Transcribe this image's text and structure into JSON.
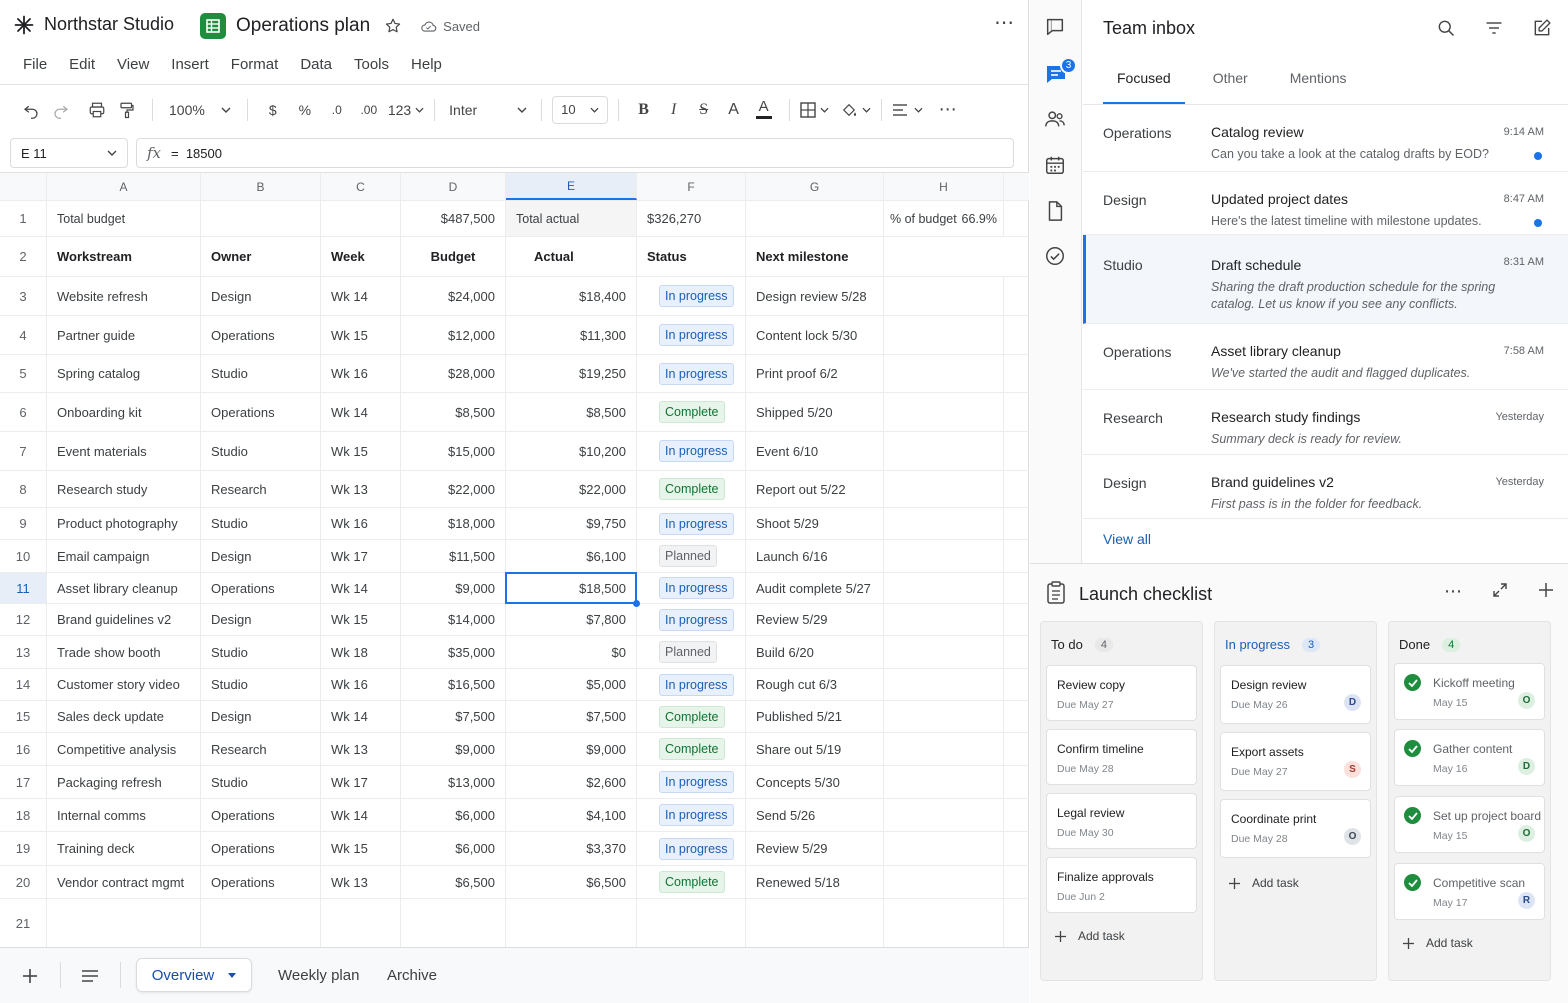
{
  "app": {
    "brand": "Northstar Studio",
    "doc_title": "Operations plan",
    "saved": "Saved"
  },
  "menu": [
    "File",
    "Edit",
    "View",
    "Insert",
    "Format",
    "Data",
    "Tools",
    "Help"
  ],
  "toolbar": {
    "zoom": "100%",
    "currency": "$",
    "percent": "%",
    "dec_less": ".0",
    "dec_more": ".00",
    "number_format": "123",
    "font": "Inter",
    "font_size": "10"
  },
  "formula_bar": {
    "cell_ref": "E 11",
    "fx": "fx",
    "formula": "=  18500"
  },
  "columns": [
    "A",
    "B",
    "C",
    "D",
    "E",
    "F",
    "G",
    "H"
  ],
  "row1": {
    "row": "1",
    "a": "Total budget",
    "d": "$487,500",
    "e": "Total actual",
    "f": "$326,270",
    "h_label": "% of budget",
    "h_value": "66.9%"
  },
  "row2": {
    "row": "2",
    "headers": [
      "Workstream",
      "Owner",
      "Week",
      "Budget",
      "Actual",
      "Status",
      "Next milestone"
    ]
  },
  "rows": [
    {
      "row": "3",
      "workstream": "Website refresh",
      "owner": "Design",
      "week": "Wk 14",
      "budget": "$24,000",
      "actual": "$18,400",
      "status": "In progress",
      "status_kind": "progress",
      "milestone": "Design review 5/28"
    },
    {
      "row": "4",
      "workstream": "Partner guide",
      "owner": "Operations",
      "week": "Wk 15",
      "budget": "$12,000",
      "actual": "$11,300",
      "status": "In progress",
      "status_kind": "progress",
      "milestone": "Content lock 5/30"
    },
    {
      "row": "5",
      "workstream": "Spring catalog",
      "owner": "Studio",
      "week": "Wk 16",
      "budget": "$28,000",
      "actual": "$19,250",
      "status": "In progress",
      "status_kind": "progress",
      "milestone": "Print proof 6/2"
    },
    {
      "row": "6",
      "workstream": "Onboarding kit",
      "owner": "Operations",
      "week": "Wk 14",
      "budget": "$8,500",
      "actual": "$8,500",
      "status": "Complete",
      "status_kind": "done",
      "milestone": "Shipped 5/20"
    },
    {
      "row": "7",
      "workstream": "Event materials",
      "owner": "Studio",
      "week": "Wk 15",
      "budget": "$15,000",
      "actual": "$10,200",
      "status": "In progress",
      "status_kind": "progress",
      "milestone": "Event 6/10"
    },
    {
      "row": "8",
      "workstream": "Research study",
      "owner": "Research",
      "week": "Wk 13",
      "budget": "$22,000",
      "actual": "$22,000",
      "status": "Complete",
      "status_kind": "done",
      "milestone": "Report out 5/22"
    },
    {
      "row": "9",
      "workstream": "Product photography",
      "owner": "Studio",
      "week": "Wk 16",
      "budget": "$18,000",
      "actual": "$9,750",
      "status": "In progress",
      "status_kind": "progress",
      "milestone": "Shoot 5/29"
    },
    {
      "row": "10",
      "workstream": "Email campaign",
      "owner": "Design",
      "week": "Wk 17",
      "budget": "$11,500",
      "actual": "$6,100",
      "status": "Planned",
      "status_kind": "plan",
      "milestone": "Launch 6/16"
    },
    {
      "row": "11",
      "workstream": "Asset library cleanup",
      "owner": "Operations",
      "week": "Wk 14",
      "budget": "$9,000",
      "actual": "$18,500",
      "status": "In progress",
      "status_kind": "progress",
      "milestone": "Audit complete 5/27"
    },
    {
      "row": "12",
      "workstream": "Brand guidelines v2",
      "owner": "Design",
      "week": "Wk 15",
      "budget": "$14,000",
      "actual": "$7,800",
      "status": "In progress",
      "status_kind": "progress",
      "milestone": "Review 5/29"
    },
    {
      "row": "13",
      "workstream": "Trade show booth",
      "owner": "Studio",
      "week": "Wk 18",
      "budget": "$35,000",
      "actual": "$0",
      "status": "Planned",
      "status_kind": "plan",
      "milestone": "Build 6/20"
    },
    {
      "row": "14",
      "workstream": "Customer story video",
      "owner": "Studio",
      "week": "Wk 16",
      "budget": "$16,500",
      "actual": "$5,000",
      "status": "In progress",
      "status_kind": "progress",
      "milestone": "Rough cut 6/3"
    },
    {
      "row": "15",
      "workstream": "Sales deck update",
      "owner": "Design",
      "week": "Wk 14",
      "budget": "$7,500",
      "actual": "$7,500",
      "status": "Complete",
      "status_kind": "done",
      "milestone": "Published 5/21"
    },
    {
      "row": "16",
      "workstream": "Competitive analysis",
      "owner": "Research",
      "week": "Wk 13",
      "budget": "$9,000",
      "actual": "$9,000",
      "status": "Complete",
      "status_kind": "done",
      "milestone": "Share out 5/19"
    },
    {
      "row": "17",
      "workstream": "Packaging refresh",
      "owner": "Studio",
      "week": "Wk 17",
      "budget": "$13,000",
      "actual": "$2,600",
      "status": "In progress",
      "status_kind": "progress",
      "milestone": "Concepts 5/30"
    },
    {
      "row": "18",
      "workstream": "Internal comms",
      "owner": "Operations",
      "week": "Wk 14",
      "budget": "$6,000",
      "actual": "$4,100",
      "status": "In progress",
      "status_kind": "progress",
      "milestone": "Send 5/26"
    },
    {
      "row": "19",
      "workstream": "Training deck",
      "owner": "Operations",
      "week": "Wk 15",
      "budget": "$6,000",
      "actual": "$3,370",
      "status": "In progress",
      "status_kind": "progress",
      "milestone": "Review 5/29"
    },
    {
      "row": "20",
      "workstream": "Vendor contract mgmt",
      "owner": "Operations",
      "week": "Wk 13",
      "budget": "$6,500",
      "actual": "$6,500",
      "status": "Complete",
      "status_kind": "done",
      "milestone": "Renewed 5/18"
    }
  ],
  "row21": {
    "row": "21"
  },
  "sheet_tabs": [
    "Overview",
    "Weekly plan",
    "Archive"
  ],
  "rail": {
    "badge": "3"
  },
  "inbox": {
    "title": "Team inbox",
    "tabs": [
      "Focused",
      "Other",
      "Mentions"
    ],
    "messages": [
      {
        "team": "Operations",
        "subject": "Catalog review",
        "preview": "Can you take a look at the catalog drafts by EOD?",
        "time": "9:14 AM",
        "unread": true
      },
      {
        "team": "Design",
        "subject": "Updated project dates",
        "preview": "Here's the latest timeline with milestone updates.",
        "time": "8:47 AM",
        "unread": true
      },
      {
        "team": "Studio",
        "subject": "Draft schedule",
        "preview": "Sharing the draft production schedule for the spring catalog. Let us know if you see any conflicts.",
        "time": "8:31 AM",
        "unread": false
      },
      {
        "team": "Operations",
        "subject": "Asset library cleanup",
        "preview": "We've started the audit and flagged duplicates.",
        "time": "7:58 AM",
        "unread": false
      },
      {
        "team": "Research",
        "subject": "Research study findings",
        "preview": "Summary deck is ready for review.",
        "time": "Yesterday",
        "unread": false
      },
      {
        "team": "Design",
        "subject": "Brand guidelines v2",
        "preview": "First pass is in the folder for feedback.",
        "time": "Yesterday",
        "unread": false
      }
    ],
    "view_all": "View all"
  },
  "checklist": {
    "title": "Launch checklist",
    "columns": [
      {
        "name": "To do",
        "count": "4",
        "add": "Add task",
        "cards": [
          {
            "title": "Review copy",
            "due": "Due May 27"
          },
          {
            "title": "Confirm timeline",
            "due": "Due May 28"
          },
          {
            "title": "Legal review",
            "due": "Due May 30"
          },
          {
            "title": "Finalize approvals",
            "due": "Due Jun 2"
          }
        ]
      },
      {
        "name": "In progress",
        "count": "3",
        "add": "Add task",
        "cards": [
          {
            "title": "Design review",
            "due": "Due May 26",
            "avatar": "D",
            "avatar_bg": "#dce3f5",
            "avatar_fg": "#2b4a8b"
          },
          {
            "title": "Export assets",
            "due": "Due May 27",
            "avatar": "S",
            "avatar_bg": "#fbe0dc",
            "avatar_fg": "#a33a2c"
          },
          {
            "title": "Coordinate print",
            "due": "Due May 28",
            "avatar": "O",
            "avatar_bg": "#dfe3e8",
            "avatar_fg": "#3c4650"
          }
        ]
      },
      {
        "name": "Done",
        "count": "4",
        "add": "Add task",
        "cards": [
          {
            "title": "Kickoff meeting",
            "due": "May 15",
            "avatar": "O",
            "avatar_bg": "#dcefe0",
            "avatar_fg": "#1e6b35"
          },
          {
            "title": "Gather content",
            "due": "May 16",
            "avatar": "D",
            "avatar_bg": "#dcefe0",
            "avatar_fg": "#1e6b35"
          },
          {
            "title": "Set up project board",
            "due": "May 15",
            "avatar": "O",
            "avatar_bg": "#dcefe0",
            "avatar_fg": "#1e6b35"
          },
          {
            "title": "Competitive scan",
            "due": "May 17",
            "avatar": "R",
            "avatar_bg": "#dde5f5",
            "avatar_fg": "#2b4a8b"
          }
        ]
      }
    ]
  },
  "colors": {
    "accent": "#1a73e8",
    "sheets_green": "#1e8e3e",
    "progress_badge": "#e8f0fe",
    "complete_badge": "#e6f4ea",
    "planned_badge": "#f1f3f4"
  }
}
